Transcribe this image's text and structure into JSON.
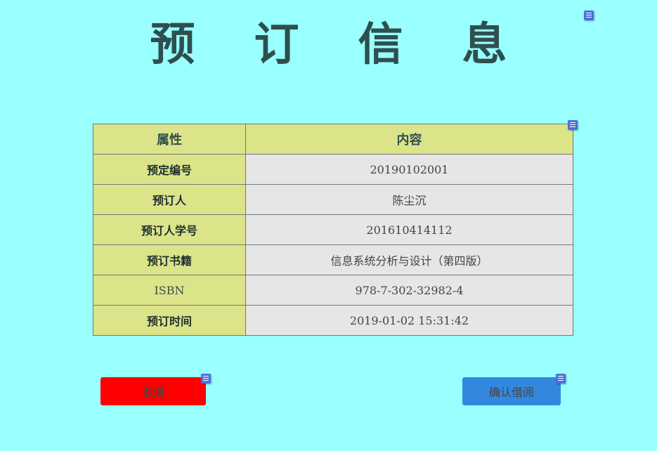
{
  "page": {
    "title_chars": [
      "预",
      "订",
      "信",
      "息"
    ]
  },
  "table": {
    "headers": [
      "属性",
      "内容"
    ],
    "rows": [
      {
        "key": "预定编号",
        "value": "20190102001"
      },
      {
        "key": "预订人",
        "value": "陈尘沉"
      },
      {
        "key": "预订人学号",
        "value": "201610414112"
      },
      {
        "key": "预订书籍",
        "value": "信息系统分析与设计（第四版）"
      },
      {
        "key": "ISBN",
        "value": "978-7-302-32982-4"
      },
      {
        "key": "预订时间",
        "value": "2019-01-02 15:31:42"
      }
    ]
  },
  "actions": {
    "cancel_label": "取消",
    "confirm_label": "确认借阅"
  },
  "colors": {
    "background": "#99ffff",
    "header_cell": "#dce48a",
    "value_cell": "#e6e6e6",
    "cancel_button": "#ff0000",
    "confirm_button": "#3388dd"
  },
  "icons": {
    "edit_handle": "menu-handle-icon"
  }
}
